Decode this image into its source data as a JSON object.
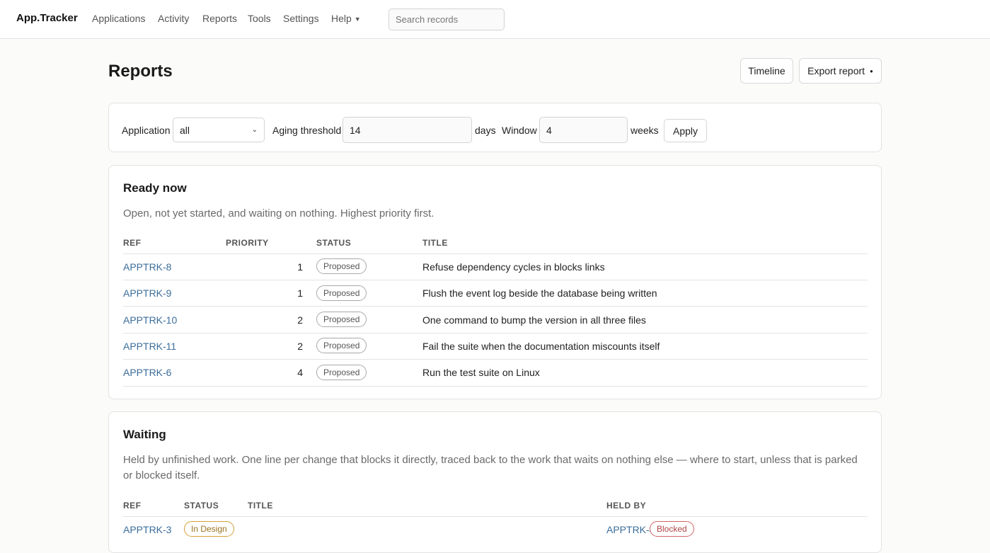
{
  "nav": {
    "brand": "App.Tracker",
    "links": [
      "Applications",
      "Activity",
      "Reports",
      "Tools",
      "Settings",
      "Help"
    ],
    "search_placeholder": "Search records"
  },
  "header": {
    "title": "Reports",
    "timeline_label": "Timeline",
    "export_label": "Export report"
  },
  "filters": {
    "application_label": "Application",
    "application_value": "all",
    "aging_label": "Aging threshold",
    "aging_value": "14",
    "aging_unit": "days",
    "window_label": "Window",
    "window_value": "4",
    "window_unit": "weeks",
    "apply_label": "Apply"
  },
  "ready": {
    "title": "Ready now",
    "description": "Open, not yet started, and waiting on nothing. Highest priority first.",
    "columns": [
      "REF",
      "PRIORITY",
      "STATUS",
      "TITLE"
    ],
    "rows": [
      {
        "ref": "APPTRK-8",
        "priority": "1",
        "status": "Proposed",
        "title": "Refuse dependency cycles in blocks links"
      },
      {
        "ref": "APPTRK-9",
        "priority": "1",
        "status": "Proposed",
        "title": "Flush the event log beside the database being written"
      },
      {
        "ref": "APPTRK-10",
        "priority": "2",
        "status": "Proposed",
        "title": "One command to bump the version in all three files"
      },
      {
        "ref": "APPTRK-11",
        "priority": "2",
        "status": "Proposed",
        "title": "Fail the suite when the documentation miscounts itself"
      },
      {
        "ref": "APPTRK-6",
        "priority": "4",
        "status": "Proposed",
        "title": "Run the test suite on Linux"
      }
    ]
  },
  "waiting": {
    "title": "Waiting",
    "description": "Held by unfinished work. One line per change that blocks it directly, traced back to the work that waits on nothing else — where to start, unless that is parked or blocked itself.",
    "columns": [
      "REF",
      "STATUS",
      "TITLE",
      "HELD BY"
    ],
    "partial_row": {
      "ref": "APPTRK-3",
      "status": "In Design",
      "held_ref": "APPTRK-4",
      "held_status": "Blocked"
    }
  },
  "colors": {
    "link": "#3b6d9a",
    "parked": "#d4a13a",
    "blocked": "#d06565"
  }
}
